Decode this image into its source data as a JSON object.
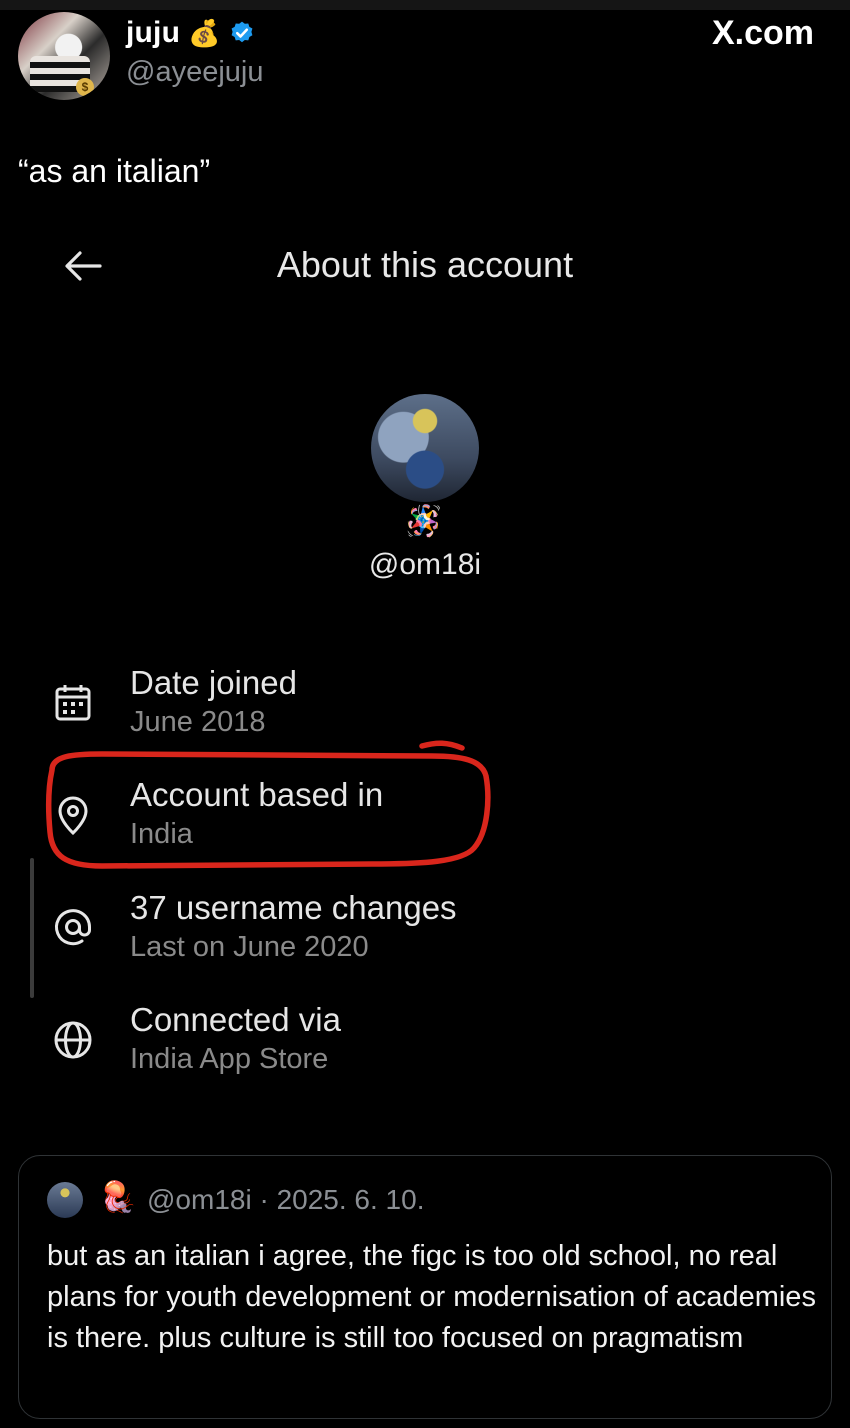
{
  "header": {
    "name": "juju",
    "name_emoji": "💰",
    "handle": "@ayeejuju",
    "brand": "X.com"
  },
  "tweet": {
    "text": "“as an italian”"
  },
  "screenshot": {
    "title": "About this account",
    "profile_handle": "@om18i",
    "profile_emoji": "🪅",
    "items": [
      {
        "icon": "calendar-icon",
        "title": "Date joined",
        "subtitle": "June 2018"
      },
      {
        "icon": "location-pin-icon",
        "title": "Account based in",
        "subtitle": "India"
      },
      {
        "icon": "at-sign-icon",
        "title": "37 username changes",
        "subtitle": "Last on June 2020"
      },
      {
        "icon": "globe-icon",
        "title": "Connected via",
        "subtitle": "India App Store"
      }
    ],
    "highlight_color": "#d9261c"
  },
  "quote": {
    "emoji": "🪼",
    "meta": "@om18i · 2025. 6. 10.",
    "text": "but as an italian i agree, the figc is too old school, no real plans for youth development or modernisation of academies is there. plus culture is still too focused on pragmatism"
  },
  "colors": {
    "background": "#000000",
    "verified_blue": "#1d9bf0",
    "muted_text": "#8b8f94"
  }
}
